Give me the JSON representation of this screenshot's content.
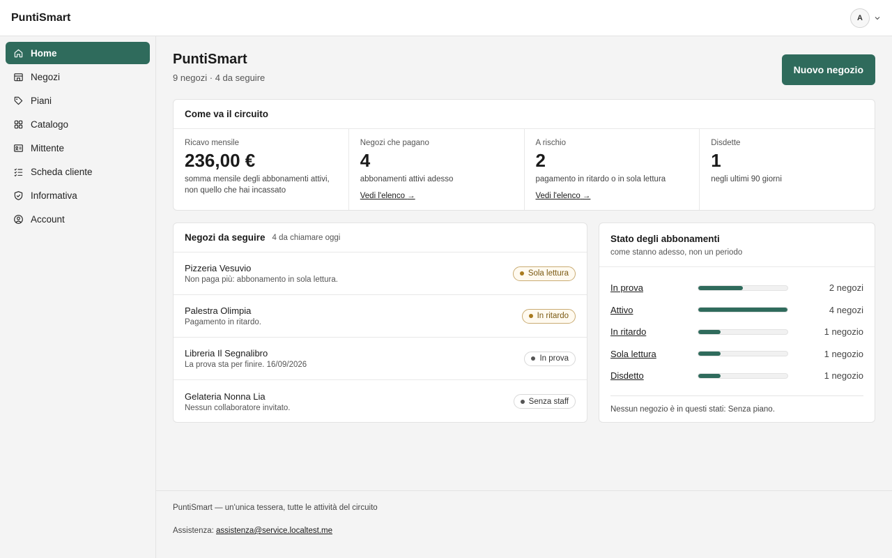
{
  "app": {
    "brand": "PuntiSmart"
  },
  "user": {
    "avatar_initial": "A"
  },
  "sidebar": {
    "items": [
      {
        "label": "Home",
        "icon": "home-icon",
        "active": true
      },
      {
        "label": "Negozi",
        "icon": "store-icon"
      },
      {
        "label": "Piani",
        "icon": "tag-icon"
      },
      {
        "label": "Catalogo",
        "icon": "grid-icon"
      },
      {
        "label": "Mittente",
        "icon": "id-card-icon"
      },
      {
        "label": "Scheda cliente",
        "icon": "checklist-icon"
      },
      {
        "label": "Informativa",
        "icon": "shield-icon"
      },
      {
        "label": "Account",
        "icon": "user-circle-icon"
      }
    ]
  },
  "header": {
    "title": "PuntiSmart",
    "subtitle": "9 negozi · 4 da seguire",
    "new_store_button": "Nuovo negozio"
  },
  "circuit": {
    "title": "Come va il circuito",
    "kpis": [
      {
        "label": "Ricavo mensile",
        "value": "236,00 €",
        "note": "somma mensile degli abbonamenti attivi, non quello che hai incassato"
      },
      {
        "label": "Negozi che pagano",
        "value": "4",
        "note": "abbonamenti attivi adesso",
        "link": "Vedi l'elenco"
      },
      {
        "label": "A rischio",
        "value": "2",
        "note": "pagamento in ritardo o in sola lettura",
        "link": "Vedi l'elenco"
      },
      {
        "label": "Disdette",
        "value": "1",
        "note": "negli ultimi 90 giorni"
      }
    ]
  },
  "follow": {
    "title": "Negozi da seguire",
    "meta": "4 da chiamare oggi",
    "rows": [
      {
        "name": "Pizzeria Vesuvio",
        "desc": "Non paga più: abbonamento in sola lettura.",
        "badge": "Sola lettura",
        "badge_tone": "warn"
      },
      {
        "name": "Palestra Olimpia",
        "desc": "Pagamento in ritardo.",
        "badge": "In ritardo",
        "badge_tone": "warn"
      },
      {
        "name": "Libreria Il Segnalibro",
        "desc": "La prova sta per finire. 16/09/2026",
        "badge": "In prova",
        "badge_tone": "neutral"
      },
      {
        "name": "Gelateria Nonna Lia",
        "desc": "Nessun collaboratore invitato.",
        "badge": "Senza staff",
        "badge_tone": "neutral"
      }
    ]
  },
  "subscriptions": {
    "title": "Stato degli abbonamenti",
    "subtitle": "come stanno adesso, non un periodo",
    "rows": [
      {
        "label": "In prova",
        "count": 2,
        "count_label": "2 negozi"
      },
      {
        "label": "Attivo",
        "count": 4,
        "count_label": "4 negozi"
      },
      {
        "label": "In ritardo",
        "count": 1,
        "count_label": "1 negozio"
      },
      {
        "label": "Sola lettura",
        "count": 1,
        "count_label": "1 negozio"
      },
      {
        "label": "Disdetto",
        "count": 1,
        "count_label": "1 negozio"
      }
    ],
    "max_count": 4,
    "note": "Nessun negozio è in questi stati: Senza piano."
  },
  "footer": {
    "tagline": "PuntiSmart — un'unica tessera, tutte le attività del circuito",
    "support_label": "Assistenza: ",
    "support_email": "assistenza@service.localtest.me"
  },
  "colors": {
    "accent": "#2f6b5c",
    "warn": "#a87a1e"
  }
}
